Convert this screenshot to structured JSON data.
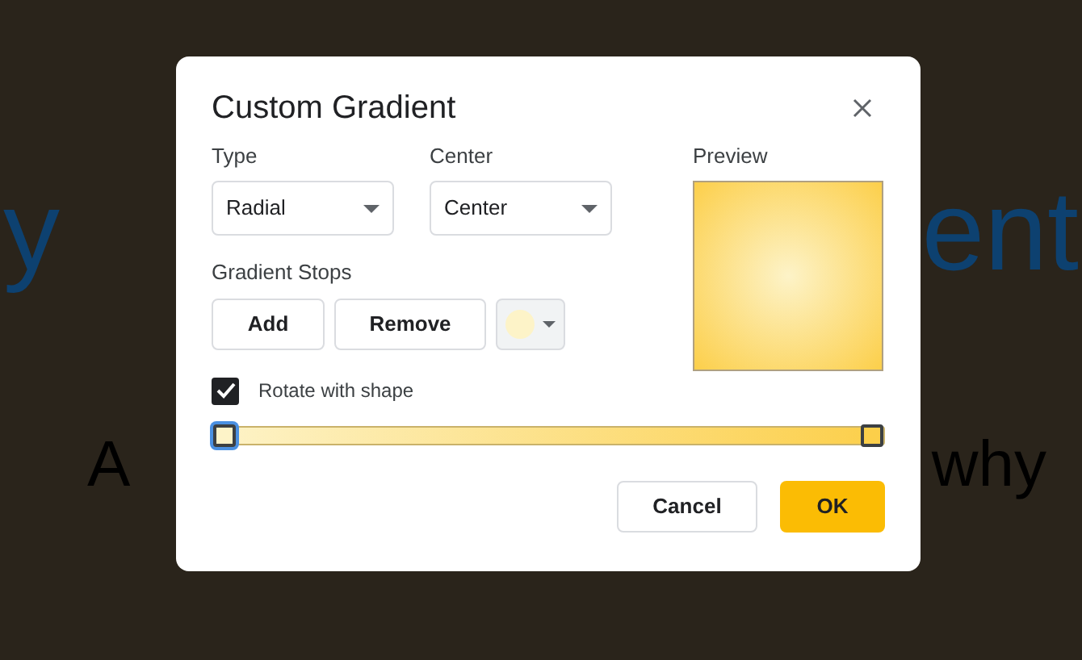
{
  "background_slide": {
    "title_left": "y",
    "title_right": "ent",
    "subtitle_left": "A",
    "subtitle_right": "why"
  },
  "dialog": {
    "title": "Custom Gradient",
    "type": {
      "label": "Type",
      "value": "Radial"
    },
    "center": {
      "label": "Center",
      "value": "Center"
    },
    "preview": {
      "label": "Preview"
    },
    "gradient_stops": {
      "label": "Gradient Stops",
      "buttons": [
        "Add",
        "Remove"
      ],
      "stops": [
        {
          "level": 0,
          "color": "#fdf3c8",
          "selected": true
        },
        {
          "level": 1,
          "color": "#fccf4a",
          "selected": false
        }
      ]
    },
    "rotate_with_shape": {
      "label": "Rotate with shape",
      "checked": true
    },
    "buttons": [
      {
        "label": "Cancel",
        "kind": "secondary"
      },
      {
        "label": "OK",
        "kind": "primary"
      }
    ]
  }
}
